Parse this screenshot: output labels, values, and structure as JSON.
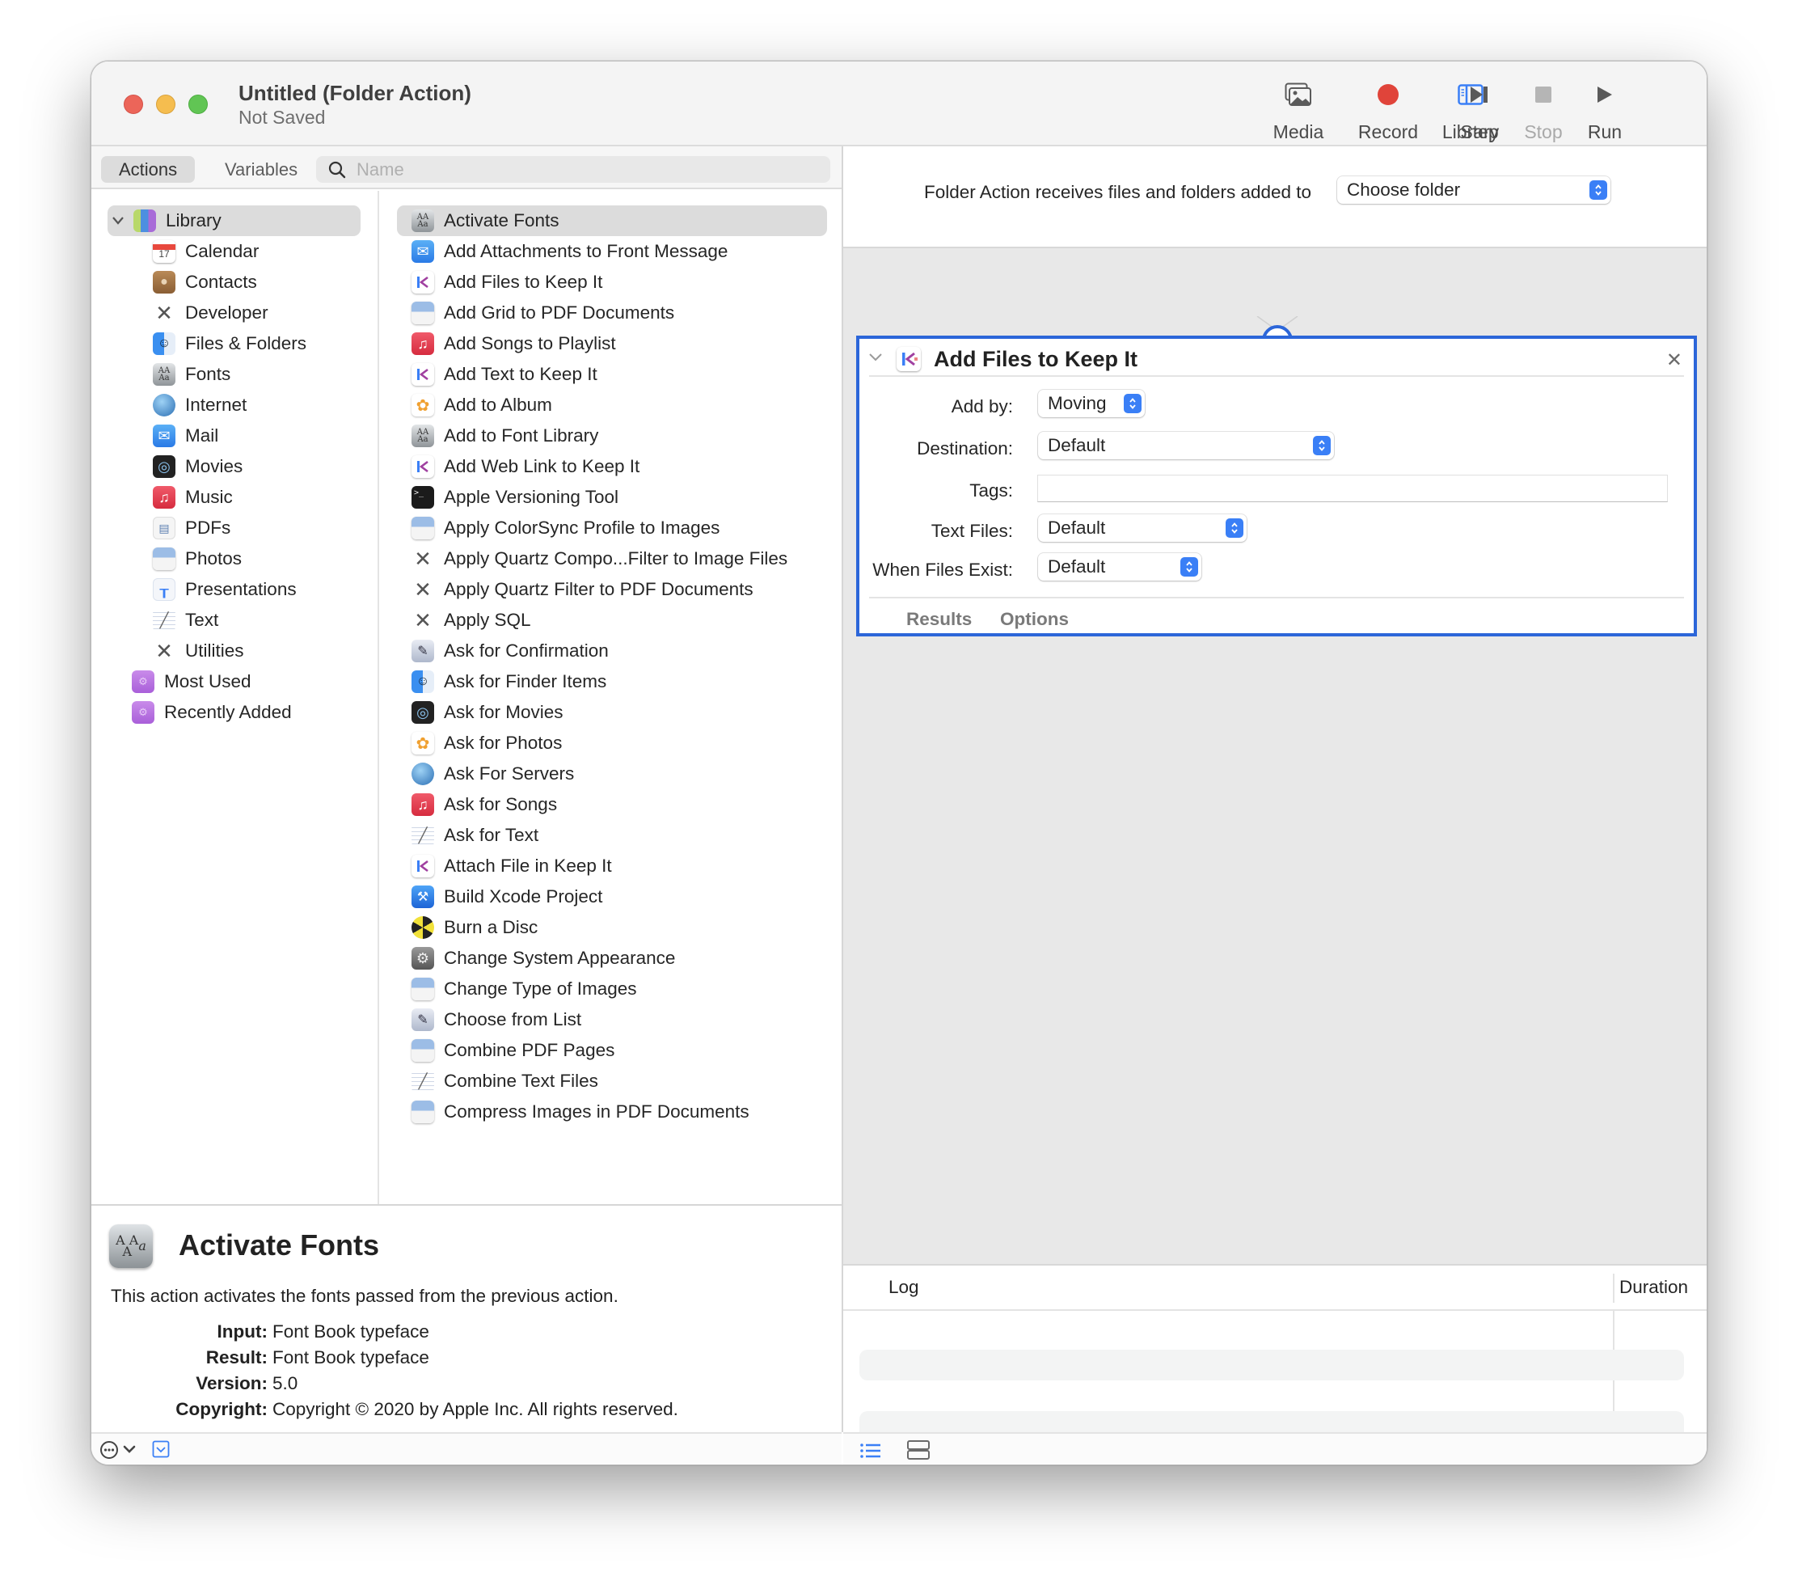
{
  "window": {
    "title": "Untitled (Folder Action)",
    "subtitle": "Not Saved"
  },
  "toolbar": {
    "library": "Library",
    "media": "Media",
    "record": "Record",
    "step": "Step",
    "stop": "Stop",
    "run": "Run",
    "record_color": "#e0443a",
    "library_color": "#3a7ff6"
  },
  "tabs": {
    "actions": "Actions",
    "variables": "Variables"
  },
  "search": {
    "placeholder": "Name",
    "value": ""
  },
  "library": {
    "root": "Library",
    "items": [
      {
        "label": "Calendar",
        "icon": "calendar-icon"
      },
      {
        "label": "Contacts",
        "icon": "contacts-icon"
      },
      {
        "label": "Developer",
        "icon": "developer-tools-icon"
      },
      {
        "label": "Files & Folders",
        "icon": "finder-icon"
      },
      {
        "label": "Fonts",
        "icon": "font-book-icon"
      },
      {
        "label": "Internet",
        "icon": "globe-icon"
      },
      {
        "label": "Mail",
        "icon": "mail-icon"
      },
      {
        "label": "Movies",
        "icon": "quicktime-icon"
      },
      {
        "label": "Music",
        "icon": "music-icon"
      },
      {
        "label": "PDFs",
        "icon": "pdf-icon"
      },
      {
        "label": "Photos",
        "icon": "preview-icon"
      },
      {
        "label": "Presentations",
        "icon": "keynote-icon"
      },
      {
        "label": "Text",
        "icon": "textedit-icon"
      },
      {
        "label": "Utilities",
        "icon": "developer-tools-icon"
      }
    ],
    "smart_groups": [
      {
        "label": "Most Used",
        "icon": "smart-folder-icon"
      },
      {
        "label": "Recently Added",
        "icon": "smart-folder-icon"
      }
    ]
  },
  "actions": [
    {
      "label": "Activate Fonts",
      "icon": "font-book-icon",
      "selected": true
    },
    {
      "label": "Add Attachments to Front Message",
      "icon": "mail-icon"
    },
    {
      "label": "Add Files to Keep It",
      "icon": "keep-it-icon"
    },
    {
      "label": "Add Grid to PDF Documents",
      "icon": "preview-icon"
    },
    {
      "label": "Add Songs to Playlist",
      "icon": "music-icon"
    },
    {
      "label": "Add Text to Keep It",
      "icon": "keep-it-icon"
    },
    {
      "label": "Add to Album",
      "icon": "photos-icon"
    },
    {
      "label": "Add to Font Library",
      "icon": "font-book-icon"
    },
    {
      "label": "Add Web Link to Keep It",
      "icon": "keep-it-icon"
    },
    {
      "label": "Apple Versioning Tool",
      "icon": "terminal-icon"
    },
    {
      "label": "Apply ColorSync Profile to Images",
      "icon": "preview-icon"
    },
    {
      "label": "Apply Quartz Compo...Filter to Image Files",
      "icon": "developer-tools-icon"
    },
    {
      "label": "Apply Quartz Filter to PDF Documents",
      "icon": "developer-tools-icon"
    },
    {
      "label": "Apply SQL",
      "icon": "developer-tools-icon"
    },
    {
      "label": "Ask for Confirmation",
      "icon": "automator-icon"
    },
    {
      "label": "Ask for Finder Items",
      "icon": "finder-icon"
    },
    {
      "label": "Ask for Movies",
      "icon": "quicktime-icon"
    },
    {
      "label": "Ask for Photos",
      "icon": "photos-icon"
    },
    {
      "label": "Ask For Servers",
      "icon": "globe-icon"
    },
    {
      "label": "Ask for Songs",
      "icon": "music-icon"
    },
    {
      "label": "Ask for Text",
      "icon": "textedit-icon"
    },
    {
      "label": "Attach File in Keep It",
      "icon": "keep-it-icon"
    },
    {
      "label": "Build Xcode Project",
      "icon": "xcode-icon"
    },
    {
      "label": "Burn a Disc",
      "icon": "burn-icon"
    },
    {
      "label": "Change System Appearance",
      "icon": "system-preferences-icon"
    },
    {
      "label": "Change Type of Images",
      "icon": "preview-icon"
    },
    {
      "label": "Choose from List",
      "icon": "automator-icon"
    },
    {
      "label": "Combine PDF Pages",
      "icon": "preview-icon"
    },
    {
      "label": "Combine Text Files",
      "icon": "textedit-icon"
    },
    {
      "label": "Compress Images in PDF Documents",
      "icon": "preview-icon"
    }
  ],
  "description": {
    "title": "Activate Fonts",
    "text": "This action activates the fonts passed from the previous action.",
    "fields": [
      {
        "label": "Input:",
        "value": "Font Book typeface"
      },
      {
        "label": "Result:",
        "value": "Font Book typeface"
      },
      {
        "label": "Version:",
        "value": "5.0"
      },
      {
        "label": "Copyright:",
        "value": "Copyright © 2020 by Apple Inc. All rights reserved."
      }
    ]
  },
  "workflow": {
    "receives_label": "Folder Action receives files and folders added to",
    "folder_value": "Choose folder",
    "card": {
      "title": "Add Files to Keep It",
      "fields": {
        "add_by": {
          "label": "Add by:",
          "value": "Moving"
        },
        "destination": {
          "label": "Destination:",
          "value": "Default"
        },
        "tags": {
          "label": "Tags:",
          "value": ""
        },
        "text_files": {
          "label": "Text Files:",
          "value": "Default"
        },
        "when_exist": {
          "label": "When Files Exist:",
          "value": "Default"
        }
      },
      "tabs": {
        "results": "Results",
        "options": "Options"
      }
    }
  },
  "log": {
    "columns": [
      "Log",
      "Duration"
    ],
    "rows": []
  }
}
